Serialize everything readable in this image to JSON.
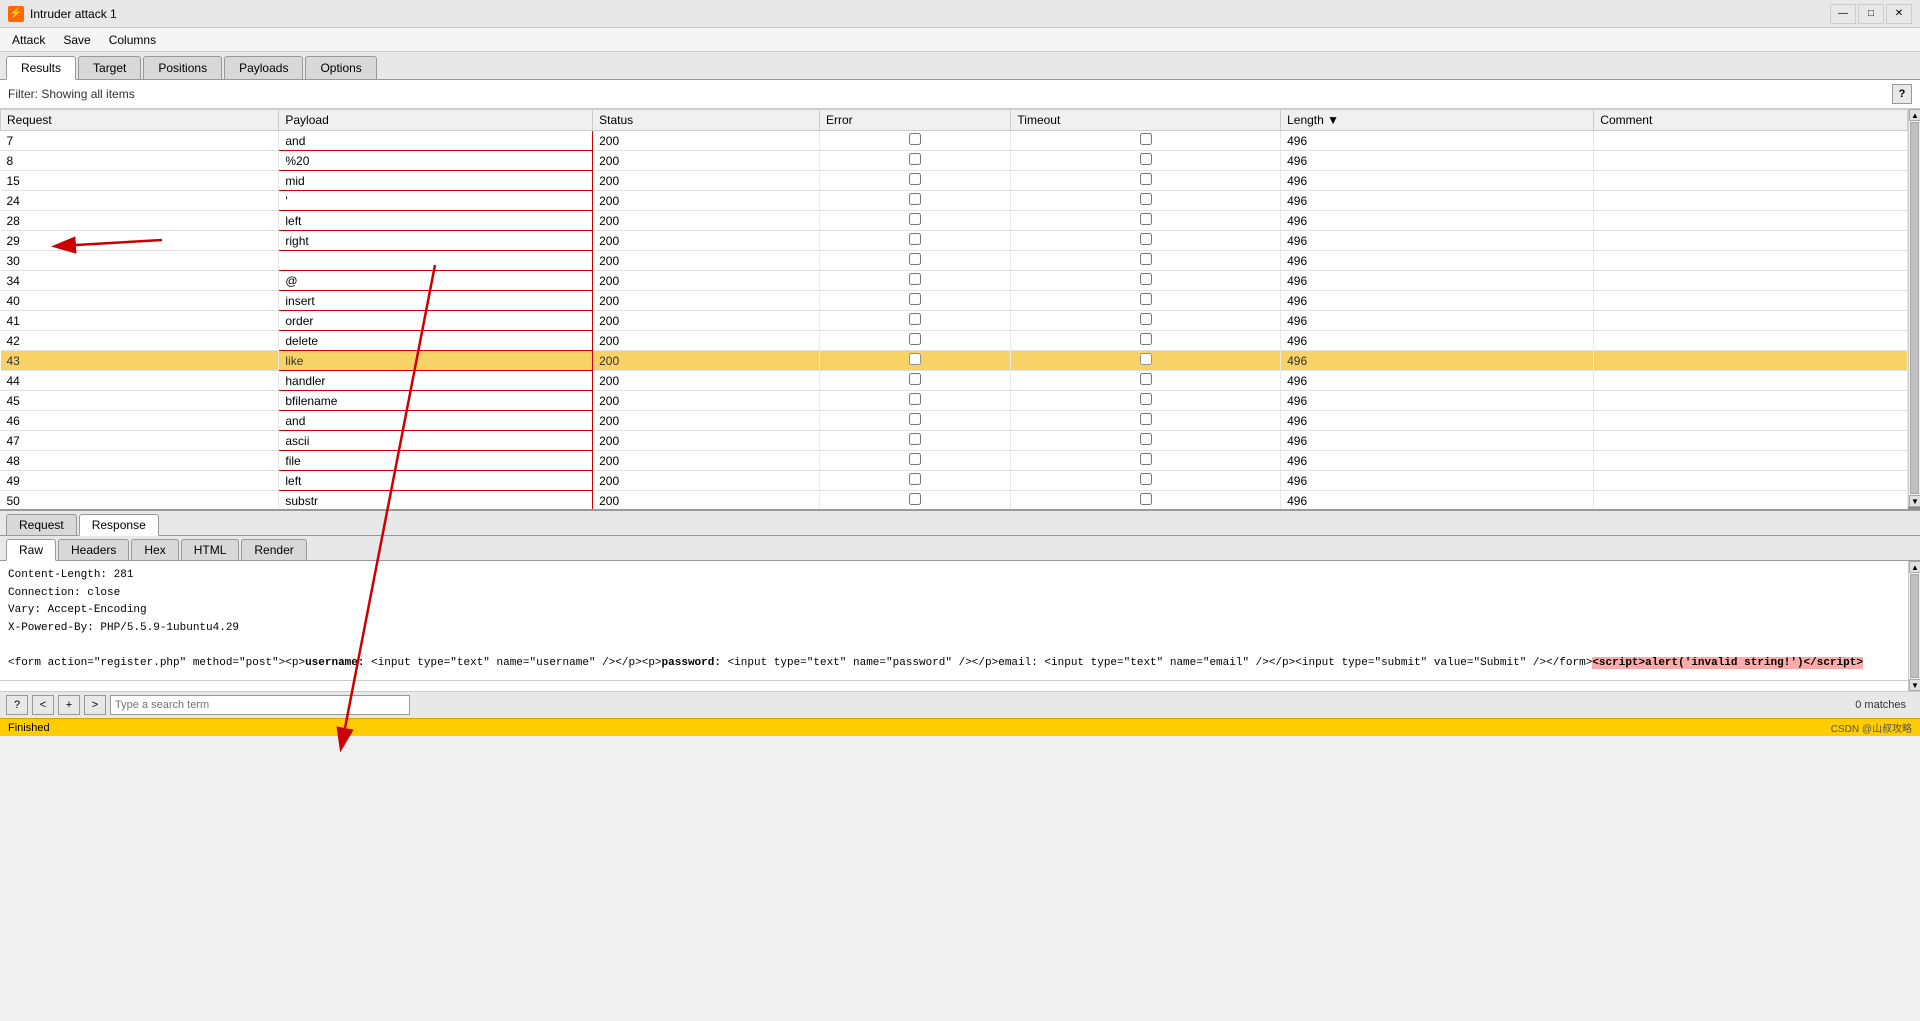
{
  "titleBar": {
    "icon": "⚡",
    "title": "Intruder attack 1",
    "minimize": "—",
    "maximize": "□",
    "close": "✕"
  },
  "menuBar": {
    "items": [
      "Attack",
      "Save",
      "Columns"
    ]
  },
  "tabs": [
    {
      "label": "Results",
      "active": true
    },
    {
      "label": "Target",
      "active": false
    },
    {
      "label": "Positions",
      "active": false
    },
    {
      "label": "Payloads",
      "active": false
    },
    {
      "label": "Options",
      "active": false
    }
  ],
  "filterBar": {
    "text": "Filter: Showing all items",
    "helpLabel": "?"
  },
  "tableColumns": [
    "Request",
    "Payload",
    "Status",
    "Error",
    "Timeout",
    "Length",
    "▼",
    "Comment"
  ],
  "tableRows": [
    {
      "request": "7",
      "payload": "and",
      "status": "200",
      "error": false,
      "timeout": false,
      "length": "496",
      "comment": "",
      "highlighted": false
    },
    {
      "request": "8",
      "payload": "%20",
      "status": "200",
      "error": false,
      "timeout": false,
      "length": "496",
      "comment": "",
      "highlighted": false
    },
    {
      "request": "15",
      "payload": "mid",
      "status": "200",
      "error": false,
      "timeout": false,
      "length": "496",
      "comment": "",
      "highlighted": false
    },
    {
      "request": "24",
      "payload": "'",
      "status": "200",
      "error": false,
      "timeout": false,
      "length": "496",
      "comment": "",
      "highlighted": false
    },
    {
      "request": "28",
      "payload": "left",
      "status": "200",
      "error": false,
      "timeout": false,
      "length": "496",
      "comment": "",
      "highlighted": false
    },
    {
      "request": "29",
      "payload": "right",
      "status": "200",
      "error": false,
      "timeout": false,
      "length": "496",
      "comment": "",
      "highlighted": false
    },
    {
      "request": "30",
      "payload": "",
      "status": "200",
      "error": false,
      "timeout": false,
      "length": "496",
      "comment": "",
      "highlighted": false
    },
    {
      "request": "34",
      "payload": "@",
      "status": "200",
      "error": false,
      "timeout": false,
      "length": "496",
      "comment": "",
      "highlighted": false
    },
    {
      "request": "40",
      "payload": "insert",
      "status": "200",
      "error": false,
      "timeout": false,
      "length": "496",
      "comment": "",
      "highlighted": false
    },
    {
      "request": "41",
      "payload": "order",
      "status": "200",
      "error": false,
      "timeout": false,
      "length": "496",
      "comment": "",
      "highlighted": false
    },
    {
      "request": "42",
      "payload": "delete",
      "status": "200",
      "error": false,
      "timeout": false,
      "length": "496",
      "comment": "",
      "highlighted": false
    },
    {
      "request": "43",
      "payload": "like",
      "status": "200",
      "error": false,
      "timeout": false,
      "length": "496",
      "comment": "",
      "highlighted": true
    },
    {
      "request": "44",
      "payload": "handler",
      "status": "200",
      "error": false,
      "timeout": false,
      "length": "496",
      "comment": "",
      "highlighted": false
    },
    {
      "request": "45",
      "payload": "bfilename",
      "status": "200",
      "error": false,
      "timeout": false,
      "length": "496",
      "comment": "",
      "highlighted": false
    },
    {
      "request": "46",
      "payload": "and",
      "status": "200",
      "error": false,
      "timeout": false,
      "length": "496",
      "comment": "",
      "highlighted": false
    },
    {
      "request": "47",
      "payload": "ascii",
      "status": "200",
      "error": false,
      "timeout": false,
      "length": "496",
      "comment": "",
      "highlighted": false
    },
    {
      "request": "48",
      "payload": "file",
      "status": "200",
      "error": false,
      "timeout": false,
      "length": "496",
      "comment": "",
      "highlighted": false
    },
    {
      "request": "49",
      "payload": "left",
      "status": "200",
      "error": false,
      "timeout": false,
      "length": "496",
      "comment": "",
      "highlighted": false
    },
    {
      "request": "50",
      "payload": "substr",
      "status": "200",
      "error": false,
      "timeout": false,
      "length": "496",
      "comment": "",
      "highlighted": false
    }
  ],
  "reqRespTabs": [
    "Request",
    "Response"
  ],
  "activeReqRespTab": "Response",
  "subTabs": [
    "Raw",
    "Headers",
    "Hex",
    "HTML",
    "Render"
  ],
  "activeSubTab": "Raw",
  "responseContent": {
    "line1": "Content-Length: 281",
    "line2": "Connection: close",
    "line3": "Vary: Accept-Encoding",
    "line4": "X-Powered-By: PHP/5.5.9-1ubuntu4.29",
    "line5": "",
    "line6pre": "<form action=\"register.php\" method=\"post\"><p>username: <input type=\"text\" name=\"username\" /></p><p>password: <input type=\"text\" name=\"password\" /></p>email: <input type=\"text\" name=\"email\" /></p><input type=\"submit\" value=\"Submit\" /></form>",
    "line6script": "<script>alert('invalid string!')</script>"
  },
  "searchBar": {
    "helpLabel": "?",
    "prevLabel": "<",
    "nextLabel": ">",
    "nextNextLabel": ">",
    "placeholder": "Type a search term",
    "matchCount": "0 matches"
  },
  "statusBar": {
    "text": "Finished"
  },
  "attribution": "CSDN @山叔攻略"
}
